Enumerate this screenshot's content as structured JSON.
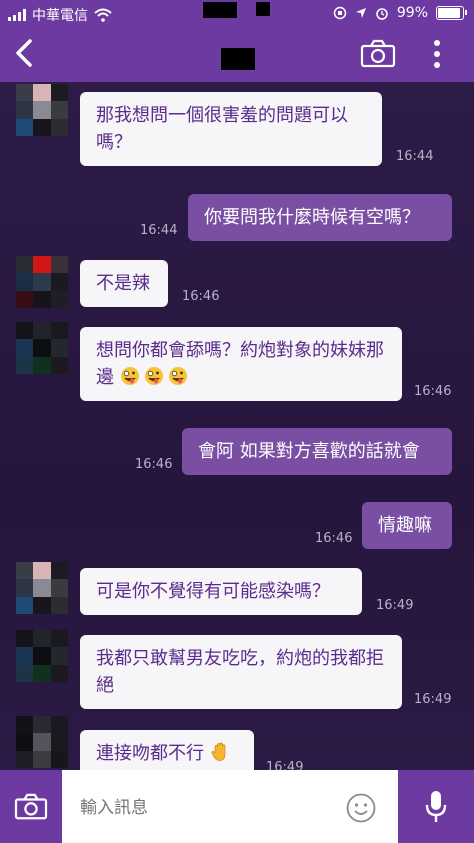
{
  "status_bar": {
    "carrier": "中華電信",
    "battery": "99%",
    "battery_level": 0.99
  },
  "nav": {
    "icons": [
      "back-arrow-icon",
      "camera-icon",
      "more-vertical-icon"
    ]
  },
  "messages": [
    {
      "side": "in",
      "text": "那我想問一個很害羞的問題可以嗎？",
      "time": "16:44"
    },
    {
      "side": "out",
      "text": "你要問我什麼時候有空嗎？",
      "time": "16:44"
    },
    {
      "side": "in",
      "text": "不是辣",
      "time": "16:46"
    },
    {
      "side": "in",
      "text": "想問你都會舔嗎？約炮對象的妹妹那邊",
      "emoji": [
        "crazy-face-icon",
        "crazy-face-icon",
        "crazy-face-icon"
      ],
      "time": "16:46"
    },
    {
      "side": "out",
      "text": "會阿 如果對方喜歡的話就會",
      "time": "16:46"
    },
    {
      "side": "out",
      "text": "情趣嘛",
      "time": "16:46"
    },
    {
      "side": "in",
      "text": "可是你不覺得有可能感染嗎？",
      "time": "16:49"
    },
    {
      "side": "in",
      "text": "我都只敢幫男友吃吃，約炮的我都拒絕",
      "time": "16:49"
    },
    {
      "side": "in",
      "text": "連接吻都不行",
      "emoji": [
        "raised-hand-icon"
      ],
      "time": "16:49"
    }
  ],
  "input": {
    "placeholder": "輸入訊息"
  },
  "colors": {
    "accent": "#6c3aa0",
    "background": "#2a1a45",
    "incoming_bubble": "#f6f5f8",
    "incoming_text": "#5c2c8c",
    "outgoing_bubble": "#7a4fa3"
  }
}
